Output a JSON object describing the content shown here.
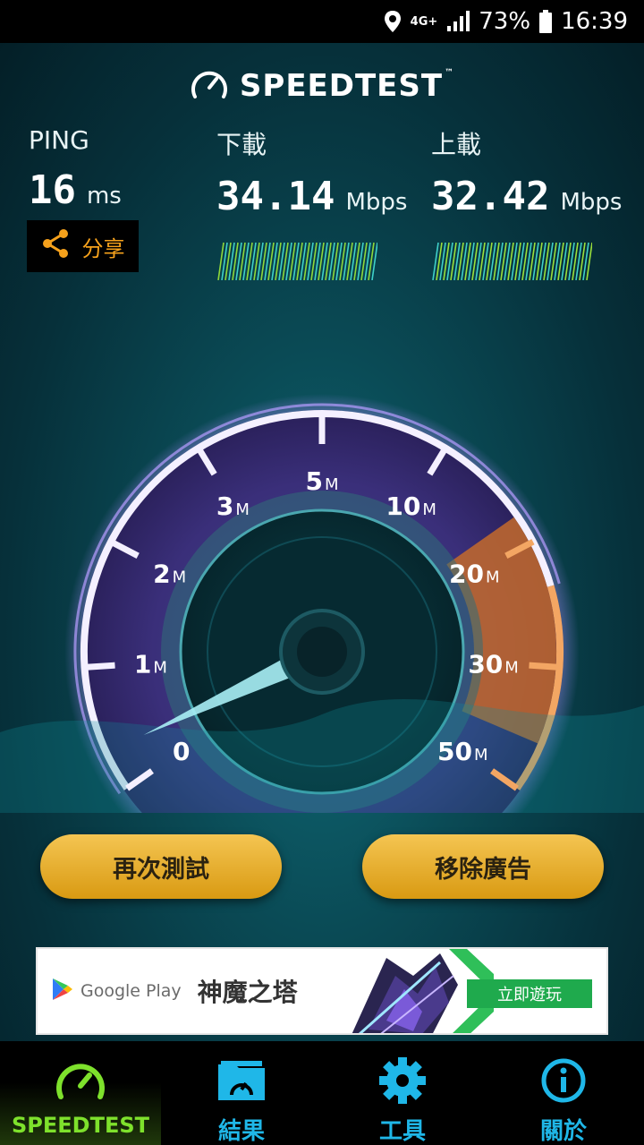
{
  "status_bar": {
    "network": "4G+",
    "battery": "73%",
    "time": "16:39",
    "icons": [
      "location-icon",
      "signal-icon",
      "battery-icon"
    ]
  },
  "app": {
    "logo_text": "SPEEDTEST",
    "logo_tm": "™"
  },
  "ping": {
    "label": "PING",
    "value": "16",
    "unit": "ms"
  },
  "download": {
    "label": "下載",
    "value": "34.14",
    "unit": "Mbps"
  },
  "upload": {
    "label": "上載",
    "value": "32.42",
    "unit": "Mbps"
  },
  "share": {
    "label": "分享"
  },
  "gauge": {
    "ticks": [
      {
        "big": "0",
        "small": ""
      },
      {
        "big": "1",
        "small": "M"
      },
      {
        "big": "2",
        "small": "M"
      },
      {
        "big": "3",
        "small": "M"
      },
      {
        "big": "5",
        "small": "M"
      },
      {
        "big": "10",
        "small": "M"
      },
      {
        "big": "20",
        "small": "M"
      },
      {
        "big": "30",
        "small": "M"
      },
      {
        "big": "50",
        "small": "M"
      }
    ]
  },
  "buttons": {
    "retest": "再次測試",
    "remove_ads": "移除廣告"
  },
  "ad": {
    "store": "Google Play",
    "title": "神魔之塔",
    "cta": "立即遊玩"
  },
  "tabs": [
    {
      "label": "SPEEDTEST",
      "icon": "speedometer-icon",
      "active": true
    },
    {
      "label": "結果",
      "icon": "results-folder-icon",
      "active": false
    },
    {
      "label": "工具",
      "icon": "gear-icon",
      "active": false
    },
    {
      "label": "關於",
      "icon": "info-icon",
      "active": false
    }
  ],
  "colors": {
    "accent_green": "#7ee12c",
    "accent_blue": "#1fb7e8",
    "share_orange": "#f5a11c",
    "button_gold": "#e8b232",
    "gauge_orange": "#e0802a",
    "gauge_purple": "#6a4fb8"
  }
}
